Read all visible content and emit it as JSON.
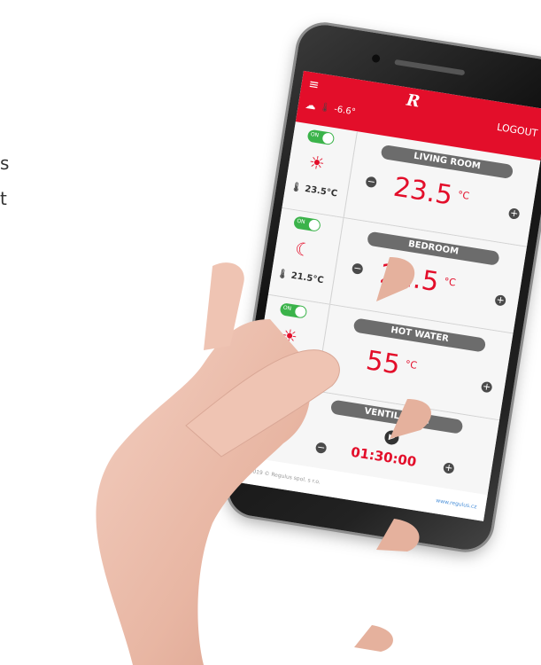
{
  "side_text": [
    "s",
    "t"
  ],
  "app": {
    "menu_icon": "hamburger-icon",
    "logo": "R",
    "logout": "LOGOUT",
    "weather_temp": "-6.6°",
    "weather_icon": "cloud-sun-icon",
    "footer_copyright": "2019 © Regulus spol. s r.o.",
    "footer_site": "www.regulus.cz"
  },
  "zones": [
    {
      "title": "LIVING ROOM",
      "toggle": "ON",
      "mode_icon": "sun-icon",
      "current_temp": "23.5",
      "current_unit": "°C",
      "set_temp": "23.5",
      "set_unit": "°C"
    },
    {
      "title": "BEDROOM",
      "toggle": "ON",
      "mode_icon": "moon-icon",
      "current_temp": "21.5",
      "current_unit": "°C",
      "set_temp": "21.5",
      "set_unit": "°C"
    },
    {
      "title": "HOT WATER",
      "toggle": "ON",
      "mode_icon": "sun-icon",
      "current_temp": "",
      "current_unit": "",
      "set_temp": "55",
      "set_unit": "°C"
    }
  ],
  "ventilation": {
    "title": "VENTILATION",
    "time": "01:30:00",
    "play_icon": "play-icon"
  },
  "colors": {
    "accent": "#e30e2a",
    "toggle_on": "#3bb34a"
  }
}
